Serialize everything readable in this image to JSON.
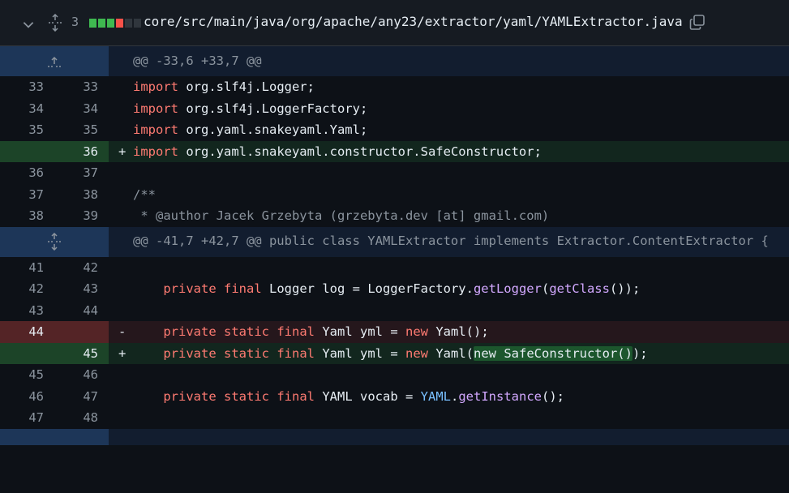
{
  "header": {
    "changes_count": "3",
    "file_path": "core/src/main/java/org/apache/any23/extractor/yaml/YAMLExtractor.java",
    "diffstat": [
      "#3fb950",
      "#3fb950",
      "#3fb950",
      "#f85149",
      "#30363d",
      "#30363d"
    ]
  },
  "hunks": [
    {
      "text": "@@ -33,6 +33,7 @@"
    },
    {
      "text": "@@ -41,7 +42,7 @@ public class YAMLExtractor implements Extractor.ContentExtractor {"
    }
  ],
  "lines": [
    {
      "old": "33",
      "new": "33",
      "sign": "",
      "t": "ctx"
    },
    {
      "old": "34",
      "new": "34",
      "sign": "",
      "t": "ctx"
    },
    {
      "old": "35",
      "new": "35",
      "sign": "",
      "t": "ctx"
    },
    {
      "old": "",
      "new": "36",
      "sign": "+",
      "t": "add"
    },
    {
      "old": "36",
      "new": "37",
      "sign": "",
      "t": "ctx"
    },
    {
      "old": "37",
      "new": "38",
      "sign": "",
      "t": "ctx"
    },
    {
      "old": "38",
      "new": "39",
      "sign": "",
      "t": "ctx"
    },
    {
      "old": "41",
      "new": "42",
      "sign": "",
      "t": "ctx"
    },
    {
      "old": "42",
      "new": "43",
      "sign": "",
      "t": "ctx"
    },
    {
      "old": "43",
      "new": "44",
      "sign": "",
      "t": "ctx"
    },
    {
      "old": "44",
      "new": "",
      "sign": "-",
      "t": "del"
    },
    {
      "old": "",
      "new": "45",
      "sign": "+",
      "t": "add"
    },
    {
      "old": "45",
      "new": "46",
      "sign": "",
      "t": "ctx"
    },
    {
      "old": "46",
      "new": "47",
      "sign": "",
      "t": "ctx"
    },
    {
      "old": "47",
      "new": "48",
      "sign": "",
      "t": "ctx"
    }
  ],
  "code": {
    "l1": {
      "kw": "import",
      "rest": " org.slf4j.Logger;"
    },
    "l2": {
      "kw": "import",
      "rest": " org.slf4j.LoggerFactory;"
    },
    "l3": {
      "kw": "import",
      "rest": " org.yaml.snakeyaml.Yaml;"
    },
    "l4": {
      "kw": "import",
      "rest": " org.yaml.snakeyaml.constructor.SafeConstructor;"
    },
    "l6": "/**",
    "l7": " * @author Jacek Grzebyta (grzebyta.dev [at] gmail.com)",
    "l9": {
      "private": "private",
      "final": "final",
      "a": " Logger log = LoggerFactory.",
      "fn": "getLogger",
      "b": "(",
      "fn2": "getClass",
      "c": "());"
    },
    "l11": {
      "private": "private",
      "static": "static",
      "final": "final",
      "a": " Yaml yml = ",
      "new": "new",
      "b": " Yaml();"
    },
    "l12": {
      "private": "private",
      "static": "static",
      "final": "final",
      "a": " Yaml yml = ",
      "new": "new",
      "b": " Yaml(",
      "hl": "new SafeConstructor()",
      "c": ");"
    },
    "l14": {
      "private": "private",
      "static": "static",
      "final": "final",
      "a": " YAML vocab = ",
      "cn": "YAML",
      "b": ".",
      "fn": "getInstance",
      "c": "();"
    }
  }
}
